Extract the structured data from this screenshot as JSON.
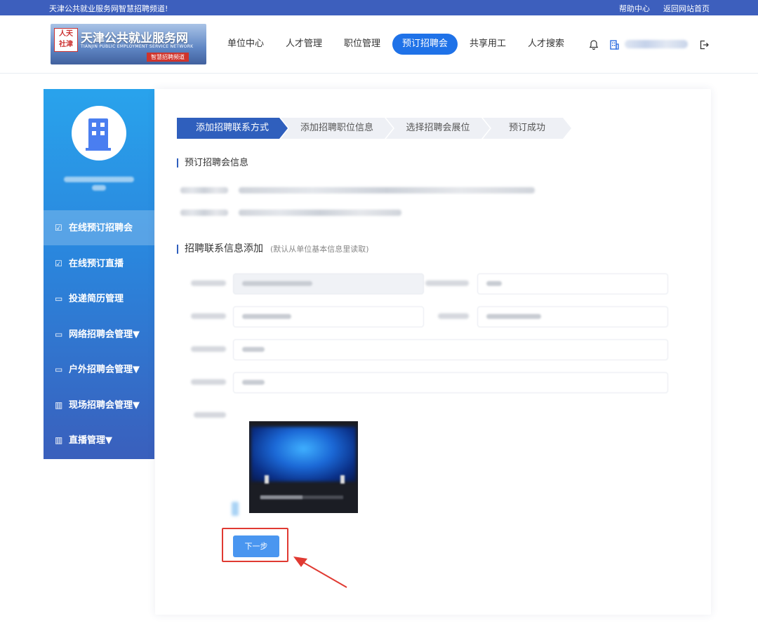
{
  "topbar": {
    "slogan": "天津公共就业服务网智慧招聘频道!",
    "help": "帮助中心",
    "home": "返回网站首页"
  },
  "logo": {
    "seal": "人天社津",
    "title": "天津公共就业服务网",
    "subtitle": "TIANJIN PUBLIC EMPLOYMENT SERVICE NETWORK",
    "badge": "智慧招聘频道"
  },
  "nav": {
    "items": [
      "单位中心",
      "人才管理",
      "职位管理",
      "预订招聘会",
      "共享用工",
      "人才搜索"
    ],
    "active_index": 3
  },
  "header_icons": [
    "bell-icon",
    "building-icon",
    "logout-icon"
  ],
  "sidebar": {
    "items": [
      {
        "label": "在线预订招聘会",
        "icon": "calendar-check-icon",
        "active": true
      },
      {
        "label": "在线预订直播",
        "icon": "calendar-check-icon",
        "active": false
      },
      {
        "label": "投递简历管理",
        "icon": "briefcase-icon",
        "active": false
      },
      {
        "label": "网络招聘会管理▼",
        "icon": "briefcase-icon",
        "active": false
      },
      {
        "label": "户外招聘会管理▼",
        "icon": "briefcase-icon",
        "active": false
      },
      {
        "label": "现场招聘会管理▼",
        "icon": "building-icon",
        "active": false
      },
      {
        "label": "直播管理▼",
        "icon": "building-icon",
        "active": false
      }
    ]
  },
  "steps": [
    "添加招聘联系方式",
    "添加招聘职位信息",
    "选择招聘会展位",
    "预订成功"
  ],
  "active_step": 0,
  "section1": {
    "title": "预订招聘会信息"
  },
  "section2": {
    "title": "招聘联系信息添加",
    "hint": "(默认从单位基本信息里读取)"
  },
  "buttons": {
    "next": "下一步"
  },
  "colors": {
    "topbar": "#3d5fbd",
    "nav_active": "#1f72e8",
    "step_active": "#2f5fbd",
    "next_button": "#4a96f0",
    "highlight": "#e03a32"
  }
}
